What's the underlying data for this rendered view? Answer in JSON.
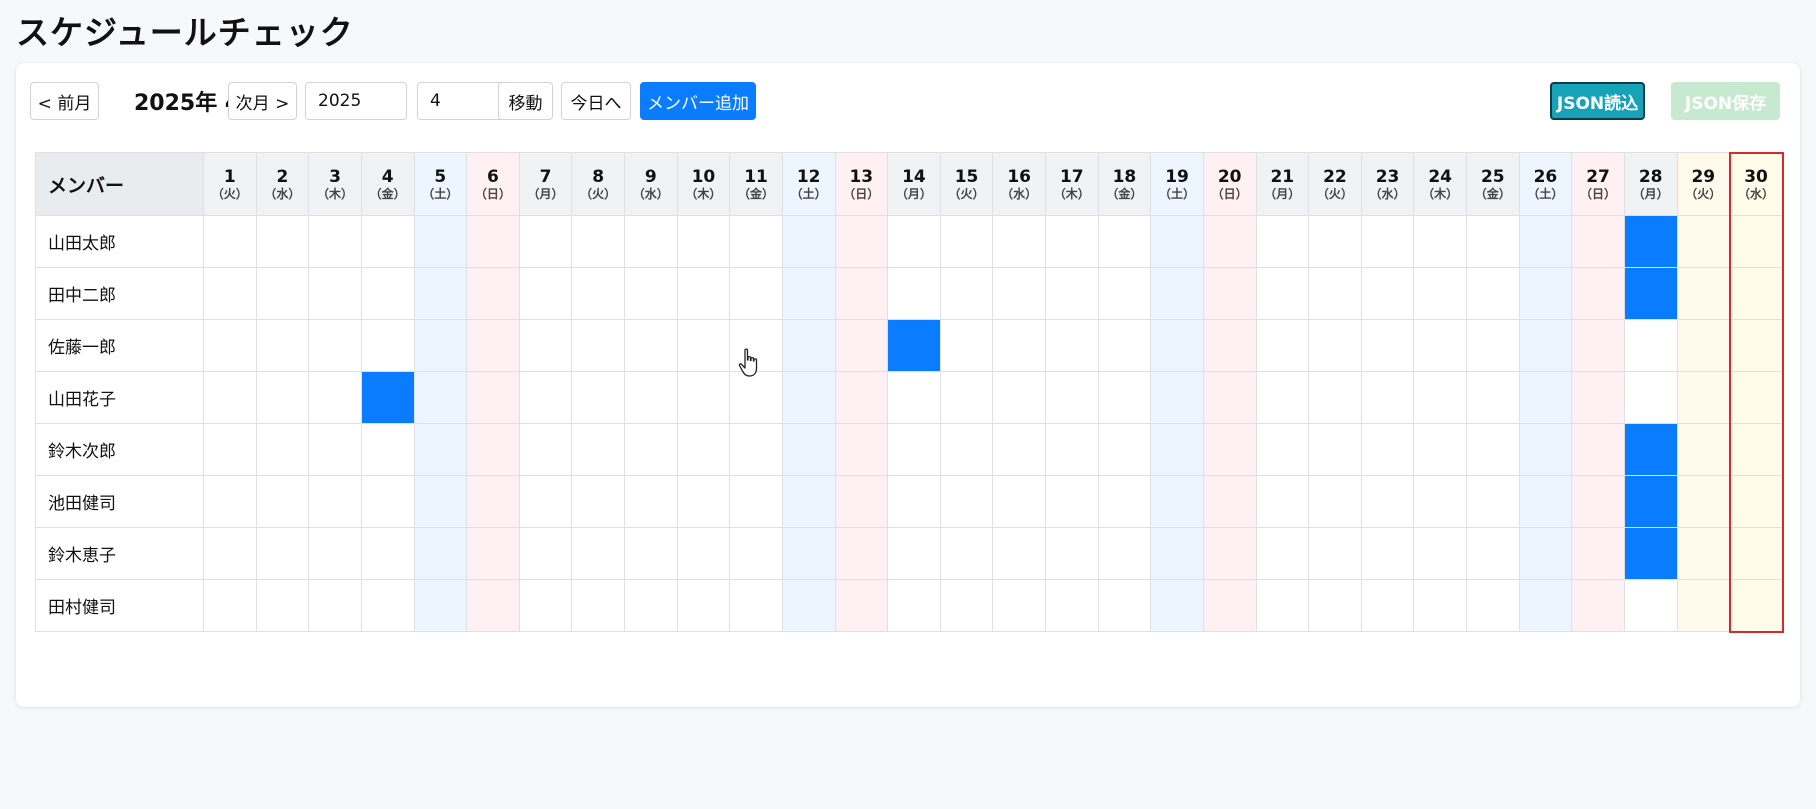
{
  "title": "スケジュールチェック",
  "toolbar": {
    "prev_label": "< 前月",
    "current_month": "2025年 4月",
    "next_label": "次月 >",
    "year_value": "2025",
    "month_value": "4",
    "go_label": "移動",
    "today_label": "今日へ",
    "add_member_label": "メンバー追加",
    "json_load_label": "JSON読込",
    "json_save_label": "JSON保存"
  },
  "table": {
    "member_header": "メンバー",
    "today": 30,
    "days": [
      {
        "d": "1",
        "w": "（火）",
        "t": ""
      },
      {
        "d": "2",
        "w": "（水）",
        "t": ""
      },
      {
        "d": "3",
        "w": "（木）",
        "t": ""
      },
      {
        "d": "4",
        "w": "（金）",
        "t": ""
      },
      {
        "d": "5",
        "w": "（土）",
        "t": "sat"
      },
      {
        "d": "6",
        "w": "（日）",
        "t": "sun"
      },
      {
        "d": "7",
        "w": "（月）",
        "t": ""
      },
      {
        "d": "8",
        "w": "（火）",
        "t": ""
      },
      {
        "d": "9",
        "w": "（水）",
        "t": ""
      },
      {
        "d": "10",
        "w": "（木）",
        "t": ""
      },
      {
        "d": "11",
        "w": "（金）",
        "t": ""
      },
      {
        "d": "12",
        "w": "（土）",
        "t": "sat"
      },
      {
        "d": "13",
        "w": "（日）",
        "t": "sun"
      },
      {
        "d": "14",
        "w": "（月）",
        "t": ""
      },
      {
        "d": "15",
        "w": "（火）",
        "t": ""
      },
      {
        "d": "16",
        "w": "（水）",
        "t": ""
      },
      {
        "d": "17",
        "w": "（木）",
        "t": ""
      },
      {
        "d": "18",
        "w": "（金）",
        "t": ""
      },
      {
        "d": "19",
        "w": "（土）",
        "t": "sat"
      },
      {
        "d": "20",
        "w": "（日）",
        "t": "sun"
      },
      {
        "d": "21",
        "w": "（月）",
        "t": ""
      },
      {
        "d": "22",
        "w": "（火）",
        "t": ""
      },
      {
        "d": "23",
        "w": "（水）",
        "t": ""
      },
      {
        "d": "24",
        "w": "（木）",
        "t": ""
      },
      {
        "d": "25",
        "w": "（金）",
        "t": ""
      },
      {
        "d": "26",
        "w": "（土）",
        "t": "sat"
      },
      {
        "d": "27",
        "w": "（日）",
        "t": "sun"
      },
      {
        "d": "28",
        "w": "（月）",
        "t": ""
      },
      {
        "d": "29",
        "w": "（火）",
        "t": "tue29"
      },
      {
        "d": "30",
        "w": "（水）",
        "t": "today"
      }
    ],
    "members": [
      {
        "name": "山田太郎",
        "filled": [
          28
        ]
      },
      {
        "name": "田中二郎",
        "filled": [
          28
        ]
      },
      {
        "name": "佐藤一郎",
        "filled": [
          14
        ]
      },
      {
        "name": "山田花子",
        "filled": [
          4
        ]
      },
      {
        "name": "鈴木次郎",
        "filled": [
          28
        ]
      },
      {
        "name": "池田健司",
        "filled": [
          28
        ]
      },
      {
        "name": "鈴木恵子",
        "filled": [
          28
        ]
      },
      {
        "name": "田村健司",
        "filled": []
      }
    ]
  },
  "colors": {
    "primary": "#0a7cff",
    "teal": "#17a2b8",
    "today_outline": "#d62b2b",
    "sat_bg": "#edf5fe",
    "sun_bg": "#fff1f3"
  },
  "icons": {
    "cursor": "hand-pointer-icon"
  }
}
